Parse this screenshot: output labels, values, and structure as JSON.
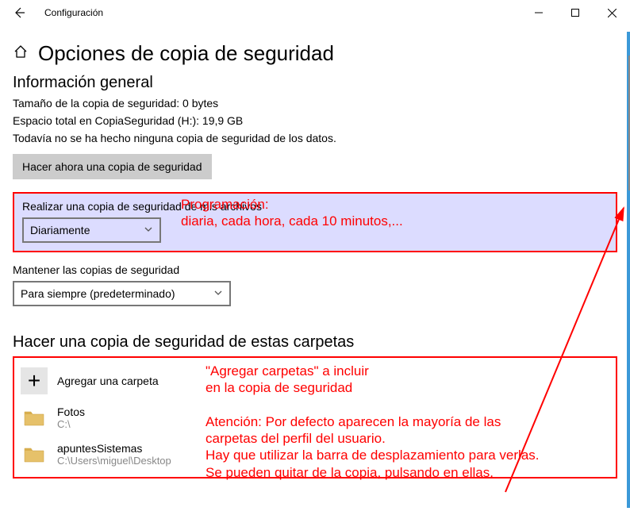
{
  "titlebar": {
    "app_title": "Configuración"
  },
  "heading": "Opciones de copia de seguridad",
  "overview": {
    "title": "Información general",
    "size_line": "Tamaño de la copia de seguridad: 0 bytes",
    "space_line": "Espacio total en CopiaSeguridad (H:): 19,9 GB",
    "status_line": "Todavía no se ha hecho ninguna copia de seguridad de los datos.",
    "backup_now_label": "Hacer ahora una copia de seguridad"
  },
  "schedule": {
    "label": "Realizar una copia de seguridad de mis archivos",
    "selected": "Diariamente"
  },
  "keep": {
    "label": "Mantener las copias de seguridad",
    "selected": "Para siempre (predeterminado)"
  },
  "folders": {
    "title": "Hacer una copia de seguridad de estas carpetas",
    "add_label": "Agregar una carpeta",
    "items": [
      {
        "name": "Fotos",
        "path": "C:\\"
      },
      {
        "name": "apuntesSistemas",
        "path": "C:\\Users\\miguel\\Desktop"
      }
    ]
  },
  "annotations": {
    "schedule_note_l1": "Programación:",
    "schedule_note_l2": "diaria, cada hora, cada 10 minutos,...",
    "folders_note_l1": "\"Agregar carpetas\" a incluir",
    "folders_note_l2": "en la copia de seguridad",
    "folders_note_l3": "Atención: Por defecto aparecen la mayoría de las",
    "folders_note_l4": "carpetas del perfil del usuario.",
    "folders_note_l5": "Hay que utilizar la barra de desplazamiento para verlas.",
    "folders_note_l6": "Se pueden quitar de la copia, pulsando en ellas."
  }
}
